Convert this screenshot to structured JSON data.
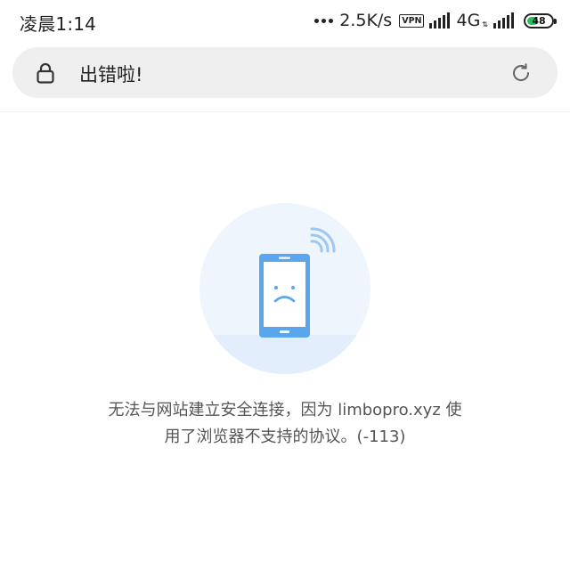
{
  "status_bar": {
    "time": "凌晨1:14",
    "net_speed": "2.5K/s",
    "vpn_label": "VPN",
    "network_type": "4G",
    "network_arrows": "⇅",
    "battery_level": "48",
    "battery_fraction": 0.48,
    "battery_color": "#22c35e"
  },
  "address_bar": {
    "title": "出错啦!",
    "lock_icon": "lock-icon",
    "reload_icon": "reload-icon"
  },
  "error": {
    "illustration": "sad-phone-icon",
    "accent_color": "#5aa6ec",
    "message": "无法与网站建立安全连接，因为 limbopro.xyz 使用了浏览器不支持的协议。(-113)"
  }
}
